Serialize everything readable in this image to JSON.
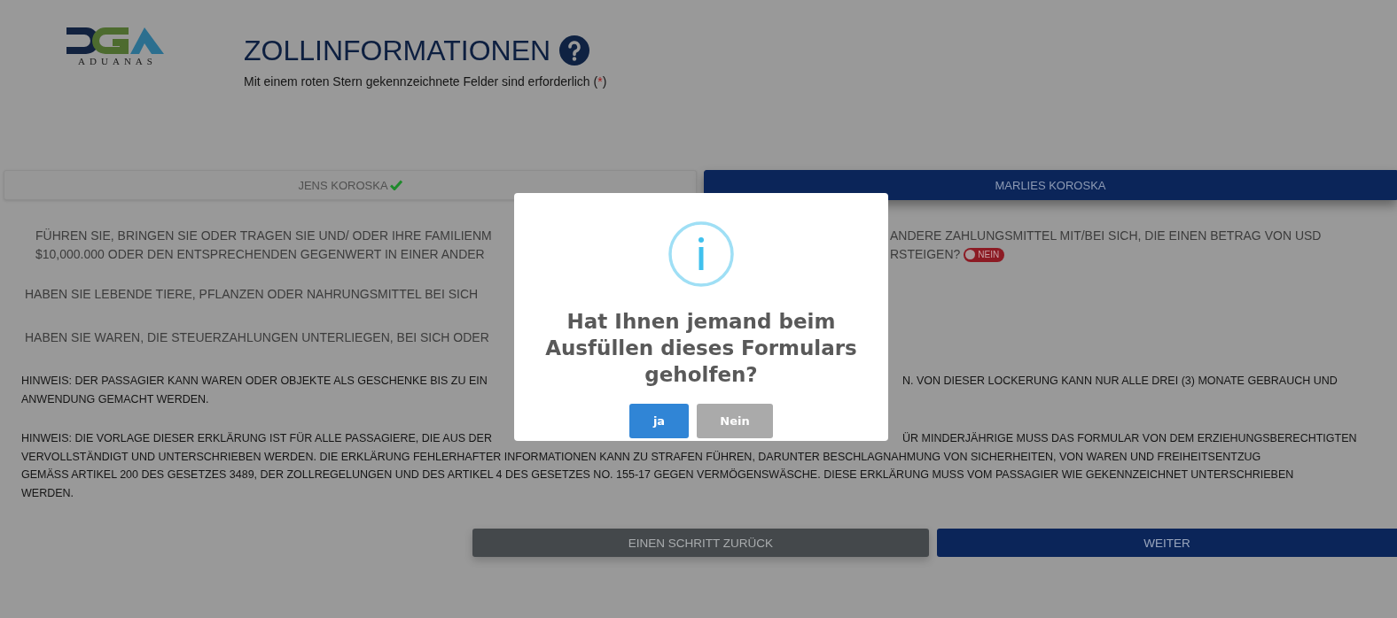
{
  "logo": {
    "text": "ADUANAS"
  },
  "header": {
    "title": "ZOLLINFORMATIONEN",
    "subtitle": {
      "before": "Mit einem roten Stern gekennzeichnete Felder sind erforderlich (",
      "mark": "*",
      "after": ")"
    }
  },
  "tabs": [
    {
      "label": "JENS KOROSKA",
      "completed": true,
      "selected": false
    },
    {
      "label": "MARLIES KOROSKA",
      "completed": false,
      "selected": true
    }
  ],
  "blocks": [
    {
      "kind": "question",
      "lines": [
        {
          "left": "FÜHREN SIE, BRINGEN SIE ODER TRAGEN SIE UND/ ODER IHRE FAMILIENM",
          "right": "ANDERE ZAHLUNGSMITTEL MIT/BEI SICH, DIE EINEN BETRAG VON USD"
        },
        {
          "left": "$10,000.000 ODER DEN ENTSPRECHENDEN GEGENWERT IN EINER ANDER",
          "right": "RSTEIGEN?",
          "toggle": {
            "label": "NEIN",
            "on": false
          }
        }
      ]
    },
    {
      "kind": "question",
      "lines": [
        {
          "left": "HABEN SIE LEBENDE TIERE, PFLANZEN ODER NAHRUNGSMITTEL BEI SICH"
        }
      ]
    },
    {
      "kind": "question",
      "lines": [
        {
          "left": "HABEN SIE WAREN, DIE STEUERZAHLUNGEN UNTERLIEGEN, BEI SICH ODER"
        }
      ]
    },
    {
      "kind": "note",
      "lines": [
        {
          "left": "HINWEIS: DER PASSAGIER KANN WAREN ODER OBJEKTE ALS GESCHENKE BIS ZU EIN",
          "right": "N. VON DIESER LOCKERUNG KANN NUR ALLE DREI (3) MONATE GEBRAUCH UND"
        },
        {
          "left": "ANWENDUNG GEMACHT WERDEN."
        }
      ]
    },
    {
      "kind": "note",
      "lines": [
        {
          "left": "HINWEIS: DIE VORLAGE DIESER ERKLÄRUNG IST FÜR ALLE PASSAGIERE, DIE AUS DER",
          "right": "ÜR MINDERJÄHRIGE MUSS DAS FORMULAR VON DEM ERZIEHUNGSBERECHTIGTEN"
        },
        {
          "full": "VERVOLLSTÄNDIGT UND UNTERSCHRIEBEN WERDEN. DIE ERKLÄRUNG FEHLERHAFTER INFORMATIONEN KANN ZU STRAFEN FÜHREN, DARUNTER BESCHLAGNAHMUNG VON SICHERHEITEN, VON WAREN UND FREIHEITSENTZUG"
        },
        {
          "full": "GEMÄSS ARTIKEL 200 DES GESETZES 3489, DER ZOLLREGELUNGEN UND DES ARTIKEL 4 DES GESETZES NO. 155-17 GEGEN VERMÖGENSWÄSCHE. DIESE ERKLÄRUNG MUSS VOM PASSAGIER WIE GEKENNZEICHNET UNTERSCHRIEBEN"
        },
        {
          "full": "WERDEN."
        }
      ]
    }
  ],
  "footer_buttons": [
    {
      "kind": "back",
      "label": "EINEN SCHRITT ZURÜCK"
    },
    {
      "kind": "next",
      "label": "WEITER"
    }
  ],
  "dialog": {
    "title": "Hat Ihnen jemand beim Ausfüllen dieses Formulars geholfen?",
    "buttons": [
      {
        "kind": "confirm",
        "label": "ja"
      },
      {
        "kind": "cancel",
        "label": "Nein"
      }
    ]
  }
}
